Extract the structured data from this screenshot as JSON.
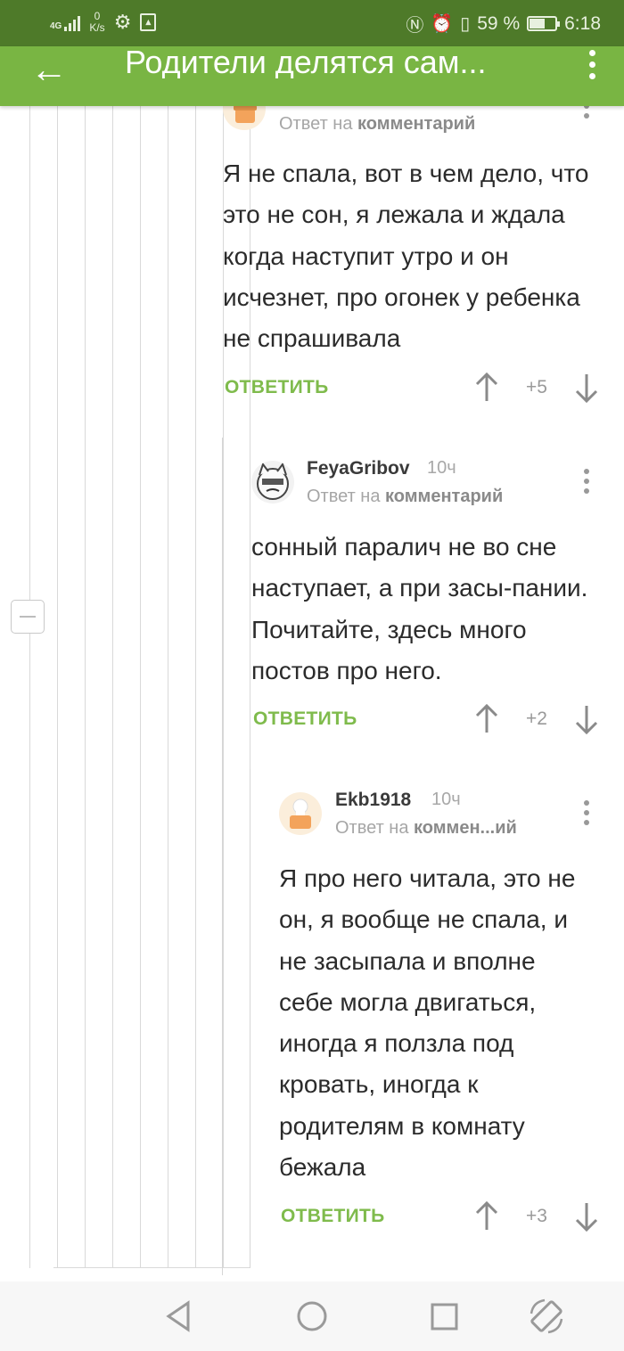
{
  "status_bar": {
    "network": "4G",
    "speed_value": "0",
    "speed_unit": "K/s",
    "battery": "59 %",
    "battery_level": 0.59,
    "time": "6:18",
    "icons": [
      "signal-icon",
      "gear-icon",
      "image-notification-icon",
      "nfc-icon",
      "alarm-icon",
      "vibrate-icon",
      "battery-icon"
    ]
  },
  "header": {
    "title": "Родители делятся сам..."
  },
  "comments": [
    {
      "reply_prefix": "Ответ на",
      "reply_target": "комментарий",
      "text": "Я не спала, вот в чем дело, что это не сон, я лежала и ждала когда наступит утро и он исчезнет, про огонек у ребенка не спрашивала",
      "reply_label": "ОТВЕТИТЬ",
      "score": "+5"
    },
    {
      "author": "FeyaGribov",
      "time": "10ч",
      "reply_prefix": "Ответ на",
      "reply_target": "комментарий",
      "text": "сонный паралич не во сне наступает, а при засы-пании. Почитайте, здесь много постов про него.",
      "reply_label": "ОТВЕТИТЬ",
      "score": "+2"
    },
    {
      "author": "Ekb1918",
      "time": "10ч",
      "reply_prefix": "Ответ на",
      "reply_target": "коммен...ий",
      "text": "Я про него читала, это не он, я вообще не спала, и не засыпала и вполне себе могла двигаться, иногда я ползла под кровать, иногда к родителям в комнату бежала",
      "reply_label": "ОТВЕТИТЬ",
      "score": "+3"
    }
  ],
  "colors": {
    "status_bar": "#4e7a29",
    "app_bar": "#79b543",
    "accent_green": "#7fbb4c",
    "muted_text": "#a6a6a6"
  },
  "navigation": {
    "icons": [
      "back-triangle-icon",
      "home-circle-icon",
      "recents-square-icon",
      "rotate-screen-icon"
    ]
  }
}
